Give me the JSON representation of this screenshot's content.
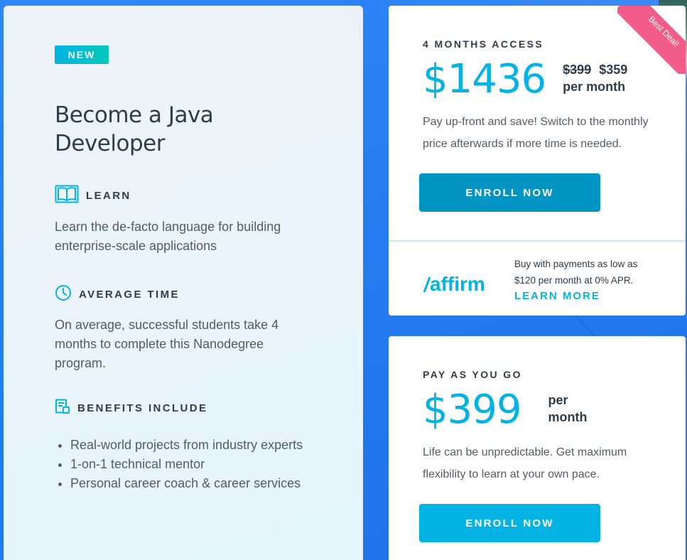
{
  "left": {
    "badge": "NEW",
    "title": "Become a Java Developer",
    "learn": {
      "heading": "LEARN",
      "text": "Learn the de-facto language for building enterprise-scale applications"
    },
    "time": {
      "heading": "AVERAGE TIME",
      "text": "On average, successful students take 4 months to complete this Nanodegree program."
    },
    "benefits": {
      "heading": "BENEFITS INCLUDE",
      "items": [
        "Real-world projects from industry experts",
        "1-on-1 technical mentor",
        "Personal career coach & career services"
      ]
    }
  },
  "plan1": {
    "ribbon": "Best Deal!",
    "label": "4 MONTHS ACCESS",
    "price": "$1436",
    "old_price": "$399",
    "new_price": "$359",
    "per": "per month",
    "description": "Pay up-front and save! Switch to the monthly price afterwards if more time is needed.",
    "button": "ENROLL NOW",
    "affirm": {
      "logo_text": "affirm",
      "text": "Buy with payments as low as $120 per month at 0% APR.",
      "link": "LEARN MORE"
    }
  },
  "plan2": {
    "label": "PAY AS YOU GO",
    "price": "$399",
    "per": "per month",
    "description": "Life can be unpredictable. Get maximum flexibility to learn at your own pace.",
    "button": "ENROLL NOW"
  },
  "colors": {
    "accent": "#02b3e4",
    "button_dark": "#0295c4",
    "ribbon": "#f25c8a",
    "background": "#2a7ef0"
  }
}
